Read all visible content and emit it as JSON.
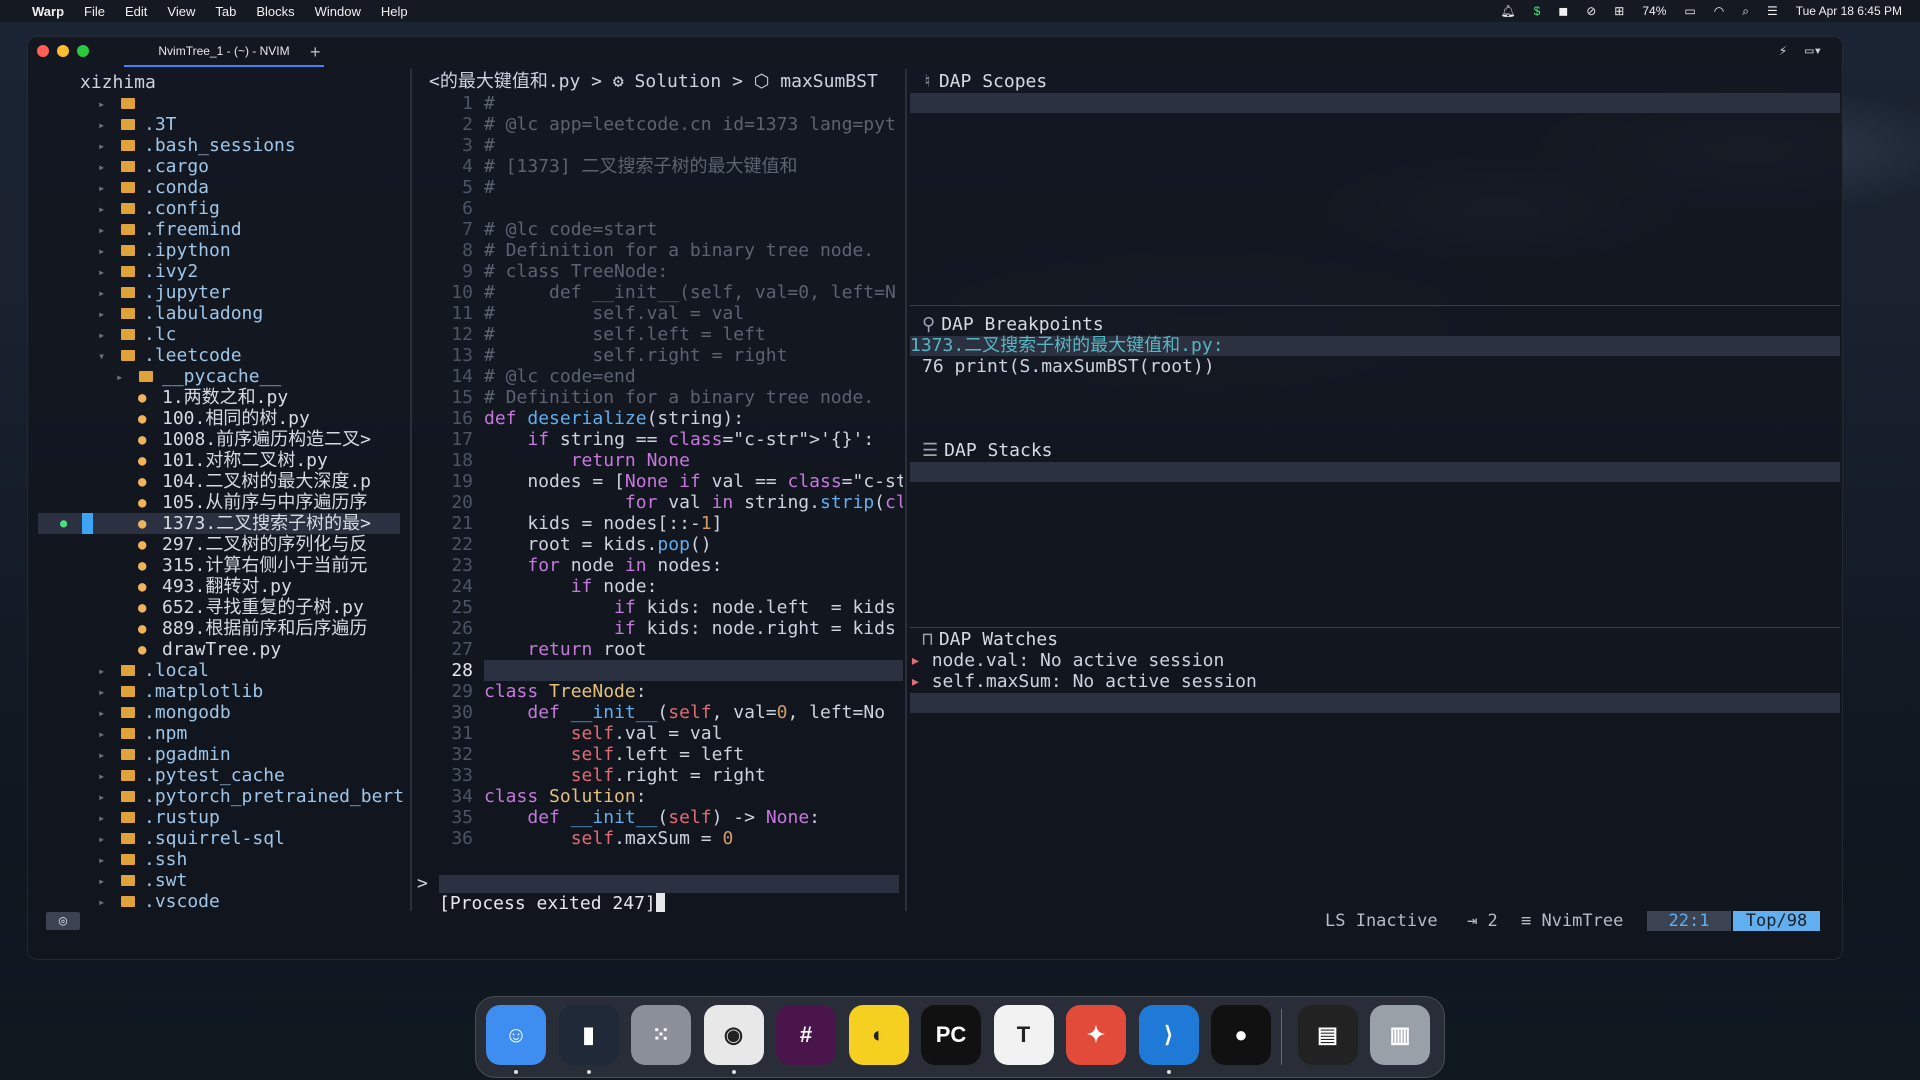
{
  "menubar": {
    "app": "Warp",
    "items": [
      "File",
      "Edit",
      "View",
      "Tab",
      "Blocks",
      "Window",
      "Help"
    ],
    "battery": "74%",
    "clock": "Tue Apr 18  6:45 PM"
  },
  "window": {
    "tab_title": "NvimTree_1 - (~) - NVIM",
    "new_tab": "+"
  },
  "tree": {
    "root": "xizhima",
    "items": [
      {
        "label": "",
        "kind": "dir"
      },
      {
        "label": ".3T",
        "kind": "dir"
      },
      {
        "label": ".bash_sessions",
        "kind": "dir"
      },
      {
        "label": ".cargo",
        "kind": "dir"
      },
      {
        "label": ".conda",
        "kind": "dir"
      },
      {
        "label": ".config",
        "kind": "dir"
      },
      {
        "label": ".freemind",
        "kind": "dir"
      },
      {
        "label": ".ipython",
        "kind": "dir"
      },
      {
        "label": ".ivy2",
        "kind": "dir"
      },
      {
        "label": ".jupyter",
        "kind": "dir"
      },
      {
        "label": ".labuladong",
        "kind": "dir"
      },
      {
        "label": ".lc",
        "kind": "dir"
      },
      {
        "label": ".leetcode",
        "kind": "open"
      },
      {
        "label": "__pycache__",
        "kind": "subdir"
      },
      {
        "label": "1.两数之和.py",
        "kind": "file"
      },
      {
        "label": "100.相同的树.py",
        "kind": "file"
      },
      {
        "label": "1008.前序遍历构造二叉>",
        "kind": "file"
      },
      {
        "label": "101.对称二叉树.py",
        "kind": "file"
      },
      {
        "label": "104.二叉树的最大深度.p",
        "kind": "file"
      },
      {
        "label": "105.从前序与中序遍历序",
        "kind": "file"
      },
      {
        "label": "1373.二叉搜索子树的最>",
        "kind": "file-sel"
      },
      {
        "label": "297.二叉树的序列化与反",
        "kind": "file"
      },
      {
        "label": "315.计算右侧小于当前元",
        "kind": "file"
      },
      {
        "label": "493.翻转对.py",
        "kind": "file"
      },
      {
        "label": "652.寻找重复的子树.py",
        "kind": "file"
      },
      {
        "label": "889.根据前序和后序遍历",
        "kind": "file"
      },
      {
        "label": "drawTree.py",
        "kind": "file"
      },
      {
        "label": ".local",
        "kind": "dir"
      },
      {
        "label": ".matplotlib",
        "kind": "dir"
      },
      {
        "label": ".mongodb",
        "kind": "dir"
      },
      {
        "label": ".npm",
        "kind": "dir"
      },
      {
        "label": ".pgadmin",
        "kind": "dir"
      },
      {
        "label": ".pytest_cache",
        "kind": "dir"
      },
      {
        "label": ".pytorch_pretrained_bert",
        "kind": "dir"
      },
      {
        "label": ".rustup",
        "kind": "dir"
      },
      {
        "label": ".squirrel-sql",
        "kind": "dir"
      },
      {
        "label": ".ssh",
        "kind": "dir"
      },
      {
        "label": ".swt",
        "kind": "dir"
      },
      {
        "label": ".vscode",
        "kind": "dir"
      }
    ]
  },
  "code": {
    "winbar": "<的最大键值和.py > ⚙ Solution > ⬡ maxSumBST",
    "current_line": 28,
    "lines": [
      "#",
      "# @lc app=leetcode.cn id=1373 lang=pyt",
      "#",
      "# [1373] 二叉搜索子树的最大键值和",
      "#",
      "",
      "# @lc code=start",
      "# Definition for a binary tree node.",
      "# class TreeNode:",
      "#     def __init__(self, val=0, left=N",
      "#         self.val = val",
      "#         self.left = left",
      "#         self.right = right",
      "# @lc code=end",
      "# Definition for a binary tree node.",
      "def deserialize(string):",
      "    if string == '{}':",
      "        return None",
      "    nodes = [None if val == 'null' els",
      "             for val in string.strip('",
      "    kids = nodes[::-1]",
      "    root = kids.pop()",
      "    for node in nodes:",
      "        if node:",
      "            if kids: node.left  = kids",
      "            if kids: node.right = kids",
      "    return root",
      "",
      "class TreeNode:",
      "    def __init__(self, val=0, left=No",
      "        self.val = val",
      "        self.left = left",
      "        self.right = right",
      "class Solution:",
      "    def __init__(self) -> None:",
      "        self.maxSum = 0"
    ]
  },
  "terminal": {
    "prompt": ">",
    "output": "[Process exited 247]"
  },
  "dap": {
    "scopes": "DAP Scopes",
    "breakpoints": "DAP Breakpoints",
    "bp_file": "1373.二叉搜索子树的最大键值和.py:",
    "bp_line": "76 print(S.maxSumBST(root))",
    "stacks": "DAP Stacks",
    "watches": "DAP Watches",
    "watch_items": [
      "node.val: No active session",
      "self.maxSum: No active session"
    ]
  },
  "status": {
    "ls": "LS Inactive",
    "indent": "⇥ 2",
    "ft": "≡ NvimTree",
    "pos": "22:1",
    "pct": "Top/98"
  },
  "dock": {
    "apps": [
      {
        "name": "finder-app-icon",
        "label": "☺",
        "color": "#3d8ef0"
      },
      {
        "name": "warp-app-icon",
        "label": "▮",
        "color": "#1f2937"
      },
      {
        "name": "launchpad-app-icon",
        "label": "⁙",
        "color": "#8a8f99"
      },
      {
        "name": "chrome-app-icon",
        "label": "◉",
        "color": "#e8e8e8"
      },
      {
        "name": "slack-app-icon",
        "label": "#",
        "color": "#4a154b"
      },
      {
        "name": "app-yellow-icon",
        "label": "◐",
        "color": "#f5d020"
      },
      {
        "name": "pycharm-app-icon",
        "label": "PC",
        "color": "#111111"
      },
      {
        "name": "typora-app-icon",
        "label": "T",
        "color": "#f2f2f2"
      },
      {
        "name": "app-red-icon",
        "label": "✦",
        "color": "#e24b3a"
      },
      {
        "name": "vscode-app-icon",
        "label": "⟩",
        "color": "#1e7ad6"
      },
      {
        "name": "qq-app-icon",
        "label": "●",
        "color": "#111111"
      },
      {
        "name": "activity-app-icon",
        "label": "▤",
        "color": "#222222"
      },
      {
        "name": "trash-icon",
        "label": "▥",
        "color": "#9aa0a8"
      }
    ]
  }
}
